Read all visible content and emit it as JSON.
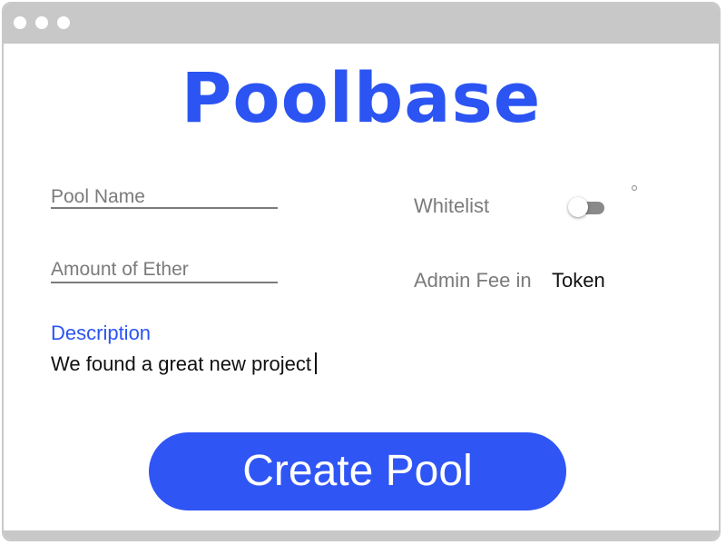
{
  "app": {
    "logo_text": "Poolbase",
    "brand_color": "#2b54f2"
  },
  "form": {
    "pool_name": {
      "placeholder": "Pool Name",
      "value": ""
    },
    "amount_of_ether": {
      "placeholder": "Amount of Ether",
      "value": ""
    },
    "whitelist": {
      "label": "Whitelist",
      "enabled": false
    },
    "admin_fee": {
      "label": "Admin Fee in",
      "value": "Token"
    },
    "description": {
      "label": "Description",
      "value": "We found a great new project"
    },
    "submit": {
      "label": "Create Pool",
      "color": "#2f55f5"
    }
  },
  "window": {
    "chrome_color": "#c8c8c8",
    "controls": [
      "window-dot-icon",
      "window-dot-icon",
      "window-dot-icon"
    ]
  }
}
